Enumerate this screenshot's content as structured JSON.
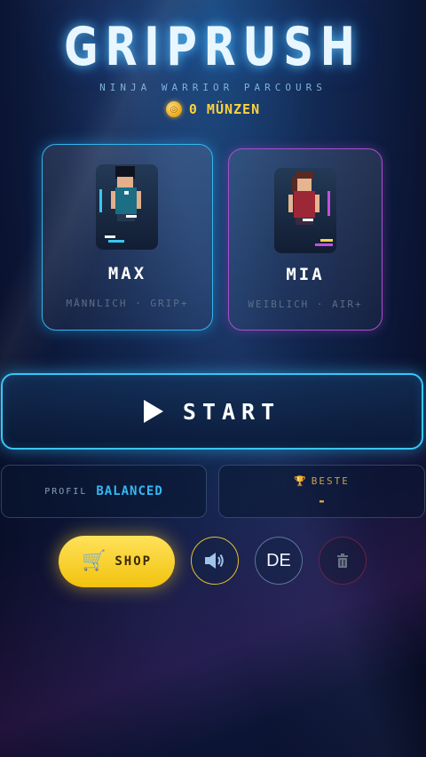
{
  "app": {
    "title": "GRIPRUSH",
    "subtitle": "NINJA WARRIOR PARCOURS",
    "coins": {
      "icon": "coin-icon",
      "label": "0 MÜNZEN"
    }
  },
  "characters": [
    {
      "name": "MAX",
      "subtitle": "MÄNNLICH · GRIP+",
      "accent": "#2fb7f0",
      "selected": true
    },
    {
      "name": "MIA",
      "subtitle": "WEIBLICH · AIR+",
      "accent": "#a94fd0",
      "selected": false
    }
  ],
  "start_button": {
    "label": "START",
    "icon": "play-icon"
  },
  "profile": {
    "label": "PROFIL",
    "value": "BALANCED"
  },
  "best": {
    "icon": "trophy-icon",
    "label": "BESTE",
    "value": "-"
  },
  "toolbar": {
    "shop": {
      "label": "SHOP",
      "icon": "cart-icon"
    },
    "sound": {
      "icon": "speaker-icon"
    },
    "language": {
      "label": "DE"
    },
    "reset": {
      "icon": "trash-icon"
    }
  },
  "colors": {
    "accent_cyan": "#38c6f5",
    "accent_purple": "#a94fd0",
    "gold": "#ffd23a"
  }
}
